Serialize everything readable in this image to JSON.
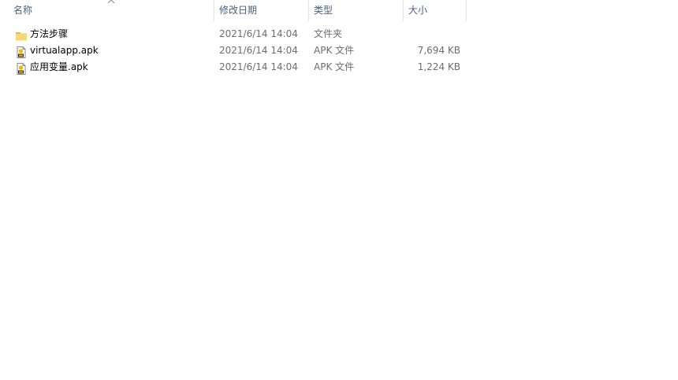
{
  "columns": {
    "name": "名称",
    "date": "修改日期",
    "type": "类型",
    "size": "大小"
  },
  "sort": {
    "column": "name",
    "direction": "ascending",
    "icon": "chevron-up-icon"
  },
  "files": [
    {
      "icon": "folder-icon",
      "name": "方法步骤",
      "date": "2021/6/14 14:04",
      "type": "文件夹",
      "size": ""
    },
    {
      "icon": "apk-file-icon",
      "name": "virtualapp.apk",
      "date": "2021/6/14 14:04",
      "type": "APK 文件",
      "size": "7,694 KB"
    },
    {
      "icon": "apk-file-icon",
      "name": "应用变量.apk",
      "date": "2021/6/14 14:04",
      "type": "APK 文件",
      "size": "1,224 KB"
    }
  ],
  "colors": {
    "header_text": "#4c607a",
    "folder": "#f8d775",
    "folder_dark": "#e8b94a",
    "detail_text": "#6d6d6d"
  }
}
